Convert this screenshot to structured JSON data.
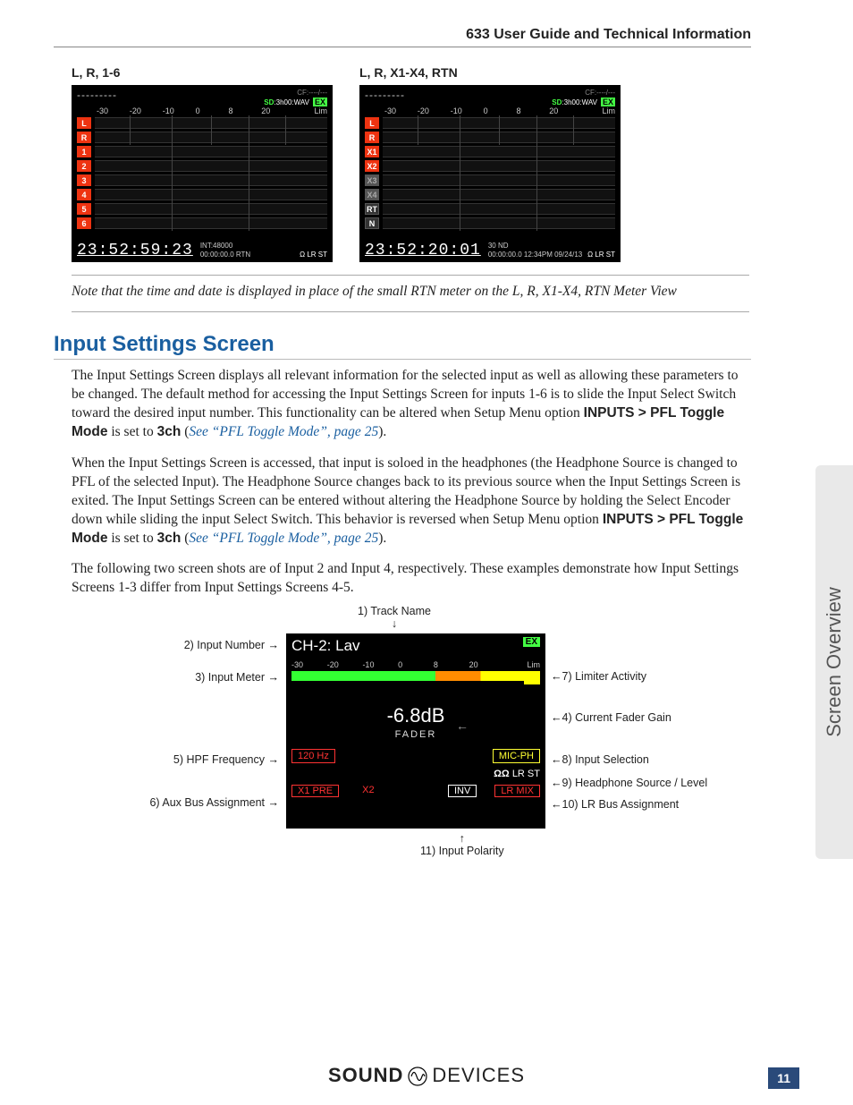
{
  "header": {
    "title": "633 User Guide and Technical Information"
  },
  "side_tab": "Screen Overview",
  "page_number": "11",
  "figures": {
    "left": {
      "caption": "L, R, 1-6",
      "cf": "CF:----/---",
      "sd_label": "SD",
      "sd_value": ":3h00:WAV",
      "ex": "EX",
      "scale": [
        "-30",
        "-20",
        "-10",
        "0",
        "8",
        "20",
        "Lim"
      ],
      "rows": [
        "L",
        "R",
        "1",
        "2",
        "3",
        "4",
        "5",
        "6"
      ],
      "timecode": "23:52:59:23",
      "mid_top": "INT:48000",
      "mid_bot": "00:00:00.0    RTN",
      "hp": "Ω LR ST"
    },
    "right": {
      "caption": "L, R, X1-X4, RTN",
      "cf": "CF:----/---",
      "sd_label": "SD",
      "sd_value": ":3h00:WAV",
      "ex": "EX",
      "scale": [
        "-30",
        "-20",
        "-10",
        "0",
        "8",
        "20",
        "Lim"
      ],
      "rows": [
        "L",
        "R",
        "X1",
        "X2",
        "X3",
        "X4",
        "RT",
        "N"
      ],
      "timecode": "23:52:20:01",
      "mid_top": "30 ND",
      "mid_bot": "00:00:00.0   12:34PM  09/24/13",
      "hp": "Ω LR ST"
    }
  },
  "note": "Note that the time and date is displayed in place of the small RTN meter on the L, R, X1-X4, RTN Meter View",
  "section_title": "Input Settings Screen",
  "para1_a": "The Input Settings Screen displays all relevant information for the selected input as well as allowing these parameters to be changed. The default method for accessing the Input Settings Screen for inputs 1-6 is to slide the Input Select Switch toward the desired input number. This functionality can be altered when Setup Menu option ",
  "para1_bold1": "INPUTS > PFL Toggle Mode",
  "para1_b": " is set to ",
  "para1_bold2": "3ch",
  "para1_c": " (",
  "para1_link": "See “PFL Toggle Mode”, page 25",
  "para1_d": ").",
  "para2_a": "When the Input Settings Screen is accessed, that input is soloed in the headphones (the Headphone Source is changed to PFL of the selected Input). The Headphone Source changes back to its previous source when the Input Settings Screen is exited. The Input Settings Screen can be entered without altering the Headphone Source by holding the Select Encoder down while sliding the input Select Switch. This behavior is reversed when Setup Menu option ",
  "para2_bold1": "INPUTS > PFL Toggle Mode",
  "para2_b": " is set to ",
  "para2_bold2": "3ch",
  "para2_c": " (",
  "para2_link": "See “PFL Toggle Mode”, page 25",
  "para2_d": ").",
  "para3": "The following two screen shots are of Input 2 and Input 4, respectively. These examples demonstrate how Input Settings Screens 1-3 differ from Input Settings Screens 4-5.",
  "annot": {
    "l1": "1) Track Name",
    "l2": "2) Input Number",
    "l3": "3) Input Meter",
    "l4": "4) Current Fader Gain",
    "l5": "5) HPF Frequency",
    "l6": "6) Aux Bus Assignment",
    "l7": "7) Limiter Activity",
    "l8": "8) Input Selection",
    "l9": "9) Headphone Source / Level",
    "l10": "10) LR Bus Assignment",
    "l11": "11) Input Polarity"
  },
  "input_screen": {
    "title": "CH-2: Lav",
    "ex": "EX",
    "scale": [
      "-30",
      "-20",
      "-10",
      "0",
      "8",
      "20",
      "Lim"
    ],
    "fader_val": "-6.8dB",
    "fader_lbl": "FADER",
    "hpf": "120 Hz",
    "input_sel": "MIC-PH",
    "hp": "LR ST",
    "aux1": "X1 PRE",
    "aux2": "X2",
    "inv": "INV",
    "lrbus": "LR MIX"
  },
  "brand_a": "SOUND",
  "brand_b": "DEVICES"
}
